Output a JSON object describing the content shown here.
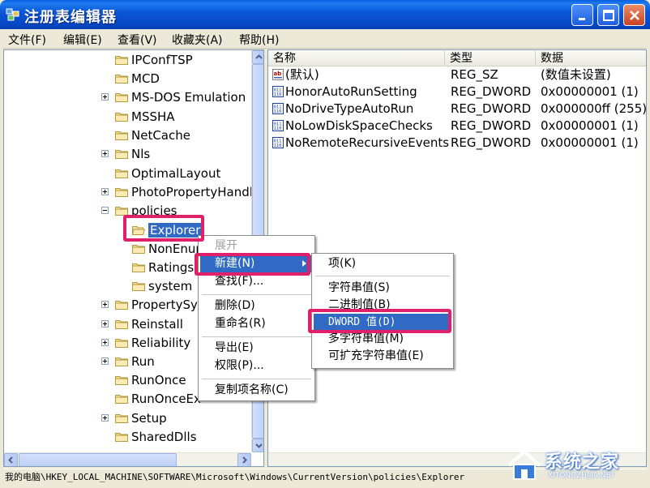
{
  "window": {
    "title": "注册表编辑器",
    "buttons": [
      "minimize-icon",
      "maximize-icon",
      "close-icon"
    ]
  },
  "menubar": [
    "文件(F)",
    "编辑(E)",
    "查看(V)",
    "收藏夹(A)",
    "帮助(H)"
  ],
  "tree": {
    "items": [
      {
        "label": "IPConfTSP",
        "expander": "none"
      },
      {
        "label": "MCD",
        "expander": "none"
      },
      {
        "label": "MS-DOS Emulation",
        "expander": "plus"
      },
      {
        "label": "MSSHA",
        "expander": "none"
      },
      {
        "label": "NetCache",
        "expander": "none"
      },
      {
        "label": "Nls",
        "expander": "plus"
      },
      {
        "label": "OptimalLayout",
        "expander": "none"
      },
      {
        "label": "PhotoPropertyHandle",
        "expander": "plus"
      },
      {
        "label": "policies",
        "expander": "minus"
      },
      {
        "label": "Explorer",
        "expander": "none",
        "selected": true
      },
      {
        "label": "NonEnum",
        "expander": "none"
      },
      {
        "label": "Ratings",
        "expander": "none"
      },
      {
        "label": "system",
        "expander": "none"
      },
      {
        "label": "PropertySys",
        "expander": "plus"
      },
      {
        "label": "Reinstall",
        "expander": "plus"
      },
      {
        "label": "Reliability",
        "expander": "plus"
      },
      {
        "label": "Run",
        "expander": "plus"
      },
      {
        "label": "RunOnce",
        "expander": "none"
      },
      {
        "label": "RunOnceEx",
        "expander": "none"
      },
      {
        "label": "Setup",
        "expander": "plus"
      },
      {
        "label": "SharedDlls",
        "expander": "none"
      }
    ]
  },
  "list": {
    "columns": [
      "名称",
      "类型",
      "数据"
    ],
    "rows": [
      {
        "name": "(默认)",
        "type": "REG_SZ",
        "data": "(数值未设置)",
        "icon": "string-value-icon"
      },
      {
        "name": "HonorAutoRunSetting",
        "type": "REG_DWORD",
        "data": "0x00000001 (1)",
        "icon": "dword-value-icon"
      },
      {
        "name": "NoDriveTypeAutoRun",
        "type": "REG_DWORD",
        "data": "0x000000ff (255)",
        "icon": "dword-value-icon"
      },
      {
        "name": "NoLowDiskSpaceChecks",
        "type": "REG_DWORD",
        "data": "0x00000001 (1)",
        "icon": "dword-value-icon"
      },
      {
        "name": "NoRemoteRecursiveEvents",
        "type": "REG_DWORD",
        "data": "0x00000001 (1)",
        "icon": "dword-value-icon"
      }
    ]
  },
  "context_menu": {
    "items": [
      {
        "label": "展开",
        "state": "disabled"
      },
      {
        "label": "新建(N)",
        "state": "highlighted",
        "submenu": true
      },
      {
        "label": "查找(F)...",
        "state": "normal"
      },
      {
        "label": "删除(D)",
        "state": "normal"
      },
      {
        "label": "重命名(R)",
        "state": "normal"
      },
      {
        "label": "导出(E)",
        "state": "normal"
      },
      {
        "label": "权限(P)...",
        "state": "normal"
      },
      {
        "label": "复制项名称(C)",
        "state": "normal"
      }
    ]
  },
  "submenu": {
    "items": [
      {
        "label": "项(K)",
        "state": "normal"
      },
      {
        "label": "字符串值(S)",
        "state": "normal"
      },
      {
        "label": "二进制值(B)",
        "state": "normal"
      },
      {
        "label": "DWORD 值(D)",
        "state": "highlighted"
      },
      {
        "label": "多字符串值(M)",
        "state": "normal"
      },
      {
        "label": "可扩充字符串值(E)",
        "state": "normal"
      }
    ]
  },
  "statusbar": "我的电脑\\HKEY_LOCAL_MACHINE\\SOFTWARE\\Microsoft\\Windows\\CurrentVersion\\policies\\Explorer",
  "watermark": {
    "text": "系统之家",
    "sub": "XITONGZHIJIA.NET"
  },
  "colors": {
    "highlight": "#316ac5",
    "annotation": "#e0206a",
    "titlebar": "#0b58d8"
  }
}
